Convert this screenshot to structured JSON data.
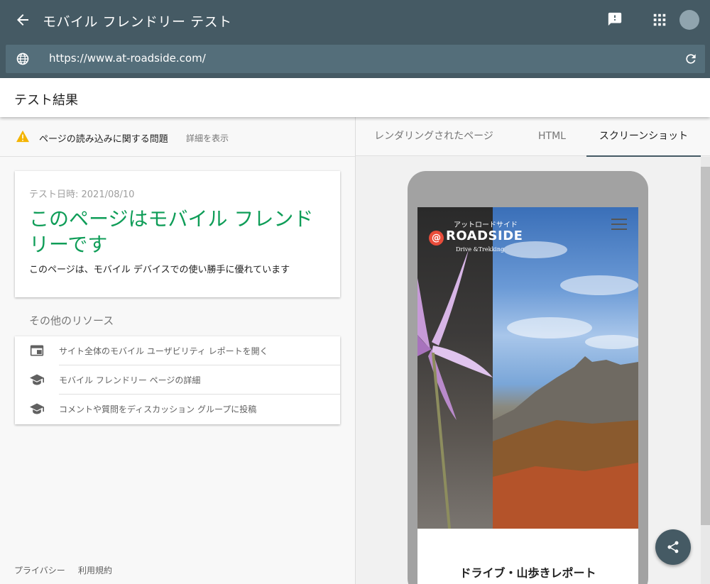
{
  "app": {
    "title": "モバイル フレンドリー テスト",
    "url": "https://www.at-roadside.com/"
  },
  "results": {
    "title": "テスト結果"
  },
  "issues": {
    "text": "ページの読み込みに関する問題",
    "link": "詳細を表示"
  },
  "verdict": {
    "date": "テスト日時: 2021/08/10",
    "headline": "このページはモバイル フレンドリーです",
    "sub": "このページは、モバイル デバイスでの使い勝手に優れています"
  },
  "resources": {
    "heading": "その他のリソース",
    "items": [
      {
        "label": "サイト全体のモバイル ユーザビリティ レポートを開く",
        "icon": "report-icon"
      },
      {
        "label": "モバイル フレンドリー ページの詳細",
        "icon": "school-icon"
      },
      {
        "label": "コメントや質問をディスカッション グループに投稿",
        "icon": "school-icon"
      }
    ]
  },
  "footer": {
    "privacy": "プライバシー",
    "terms": "利用規約"
  },
  "tabs": [
    {
      "label": "レンダリングされたページ",
      "active": false
    },
    {
      "label": "HTML",
      "active": false
    },
    {
      "label": "スクリーンショット",
      "active": true
    }
  ],
  "screenshot": {
    "brand_small": "アットロードサイド",
    "brand_at": "@",
    "brand_name": "ROADSIDE",
    "brand_tag": "Drive &Trekking",
    "headline": "ドライブ・山歩きレポート"
  },
  "colors": {
    "appbar": "#455a64",
    "urlbar": "#546e7a",
    "verdict_green": "#0f9d58",
    "warning": "#f4b400",
    "brand_red": "#e94c3a"
  }
}
